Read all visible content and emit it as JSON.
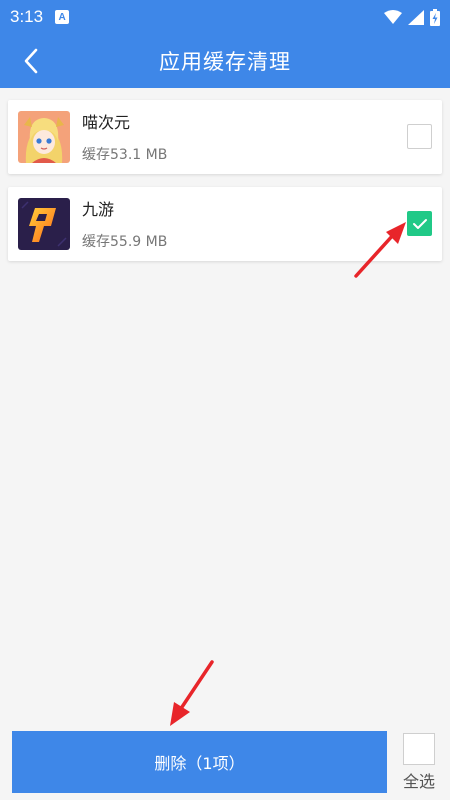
{
  "status_bar": {
    "time": "3:13",
    "notification_badge": "A",
    "icons": [
      "wifi-icon",
      "signal-icon",
      "battery-charging-icon"
    ]
  },
  "header": {
    "title": "应用缓存清理",
    "back_icon": "chevron-left-icon"
  },
  "apps": [
    {
      "name": "喵次元",
      "cache": "缓存53.1 MB",
      "checked": false,
      "icon": "anime-girl-avatar"
    },
    {
      "name": "九游",
      "cache": "缓存55.9 MB",
      "checked": true,
      "icon": "jiuyou-logo"
    }
  ],
  "footer": {
    "delete_label": "删除（1项）",
    "select_all_label": "全选",
    "select_all_checked": false
  },
  "colors": {
    "primary": "#3e87e8",
    "check_green": "#20c987",
    "arrow_red": "#e8252a"
  }
}
